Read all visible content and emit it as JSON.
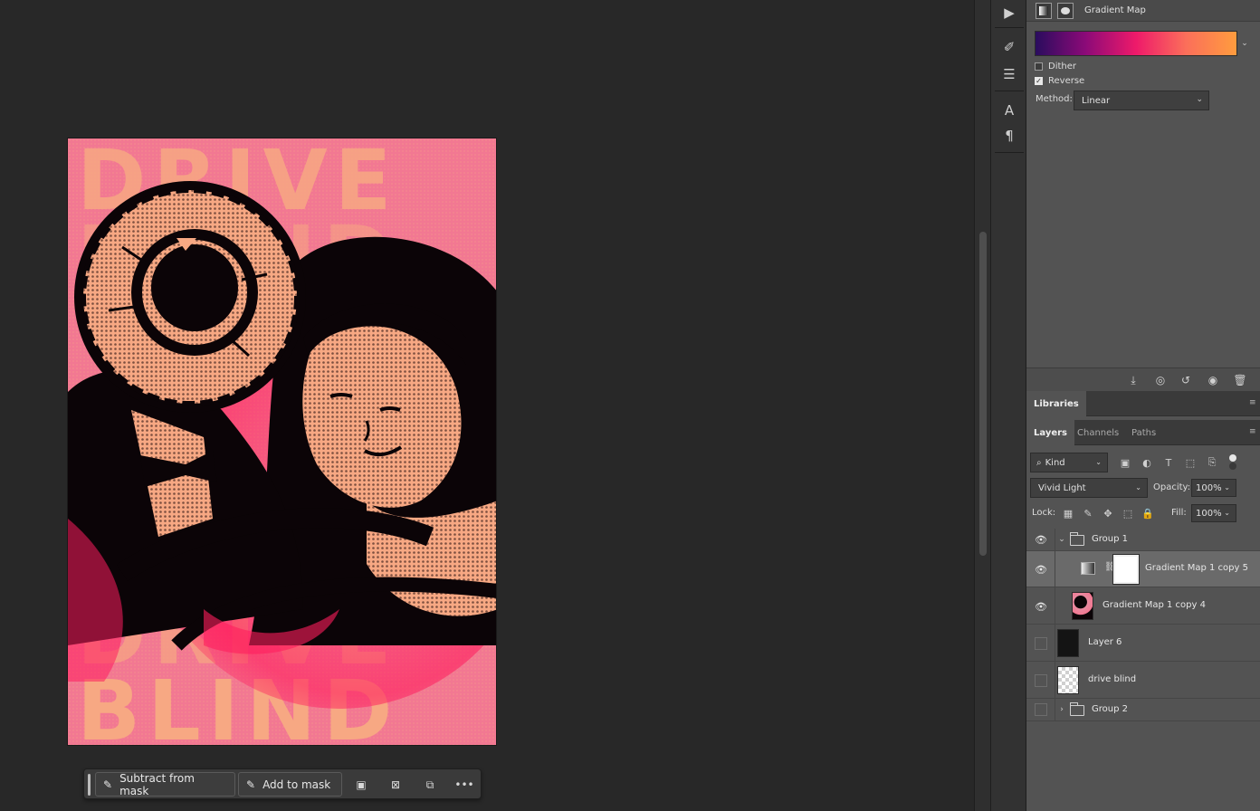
{
  "canvas": {
    "artwork": {
      "words": [
        "DRIVE",
        "BLIND",
        "DRIVE",
        "BLIND"
      ],
      "colors": {
        "base": "#f48aa0",
        "light": "#f7a883",
        "dark": "#0b0407",
        "hot": "#ff1e5e"
      }
    }
  },
  "properties": {
    "header_title": "Gradient Map",
    "gradient_colors": [
      "#2a0c5e",
      "#8c0a78",
      "#ee1a6a",
      "#fb6f5a",
      "#ff9c3e"
    ],
    "dither_label": "Dither",
    "dither_checked": false,
    "reverse_label": "Reverse",
    "reverse_checked": true,
    "method_label": "Method:",
    "method_value": "Linear"
  },
  "libraries": {
    "tab_label": "Libraries"
  },
  "layers_panel": {
    "tabs": [
      "Layers",
      "Channels",
      "Paths"
    ],
    "filter_kind": "Kind",
    "blend_mode": "Vivid Light",
    "opacity_label": "Opacity:",
    "opacity_value": "100%",
    "lock_label": "Lock:",
    "fill_label": "Fill:",
    "fill_value": "100%",
    "layers": [
      {
        "name": "Group 1",
        "visible": true,
        "type": "group",
        "expanded": true
      },
      {
        "name": "Gradient Map 1 copy 5",
        "visible": true,
        "type": "adjustment",
        "selected": true
      },
      {
        "name": "Gradient Map 1 copy 4",
        "visible": true,
        "type": "pixel"
      },
      {
        "name": "Layer 6",
        "visible": false,
        "type": "pixel"
      },
      {
        "name": "drive blind",
        "visible": false,
        "type": "transparent"
      },
      {
        "name": "Group 2",
        "visible": false,
        "type": "group",
        "expanded": false
      }
    ]
  },
  "task_bar": {
    "subtract_label": "Subtract from mask",
    "add_label": "Add to mask",
    "more_label": "•••"
  }
}
